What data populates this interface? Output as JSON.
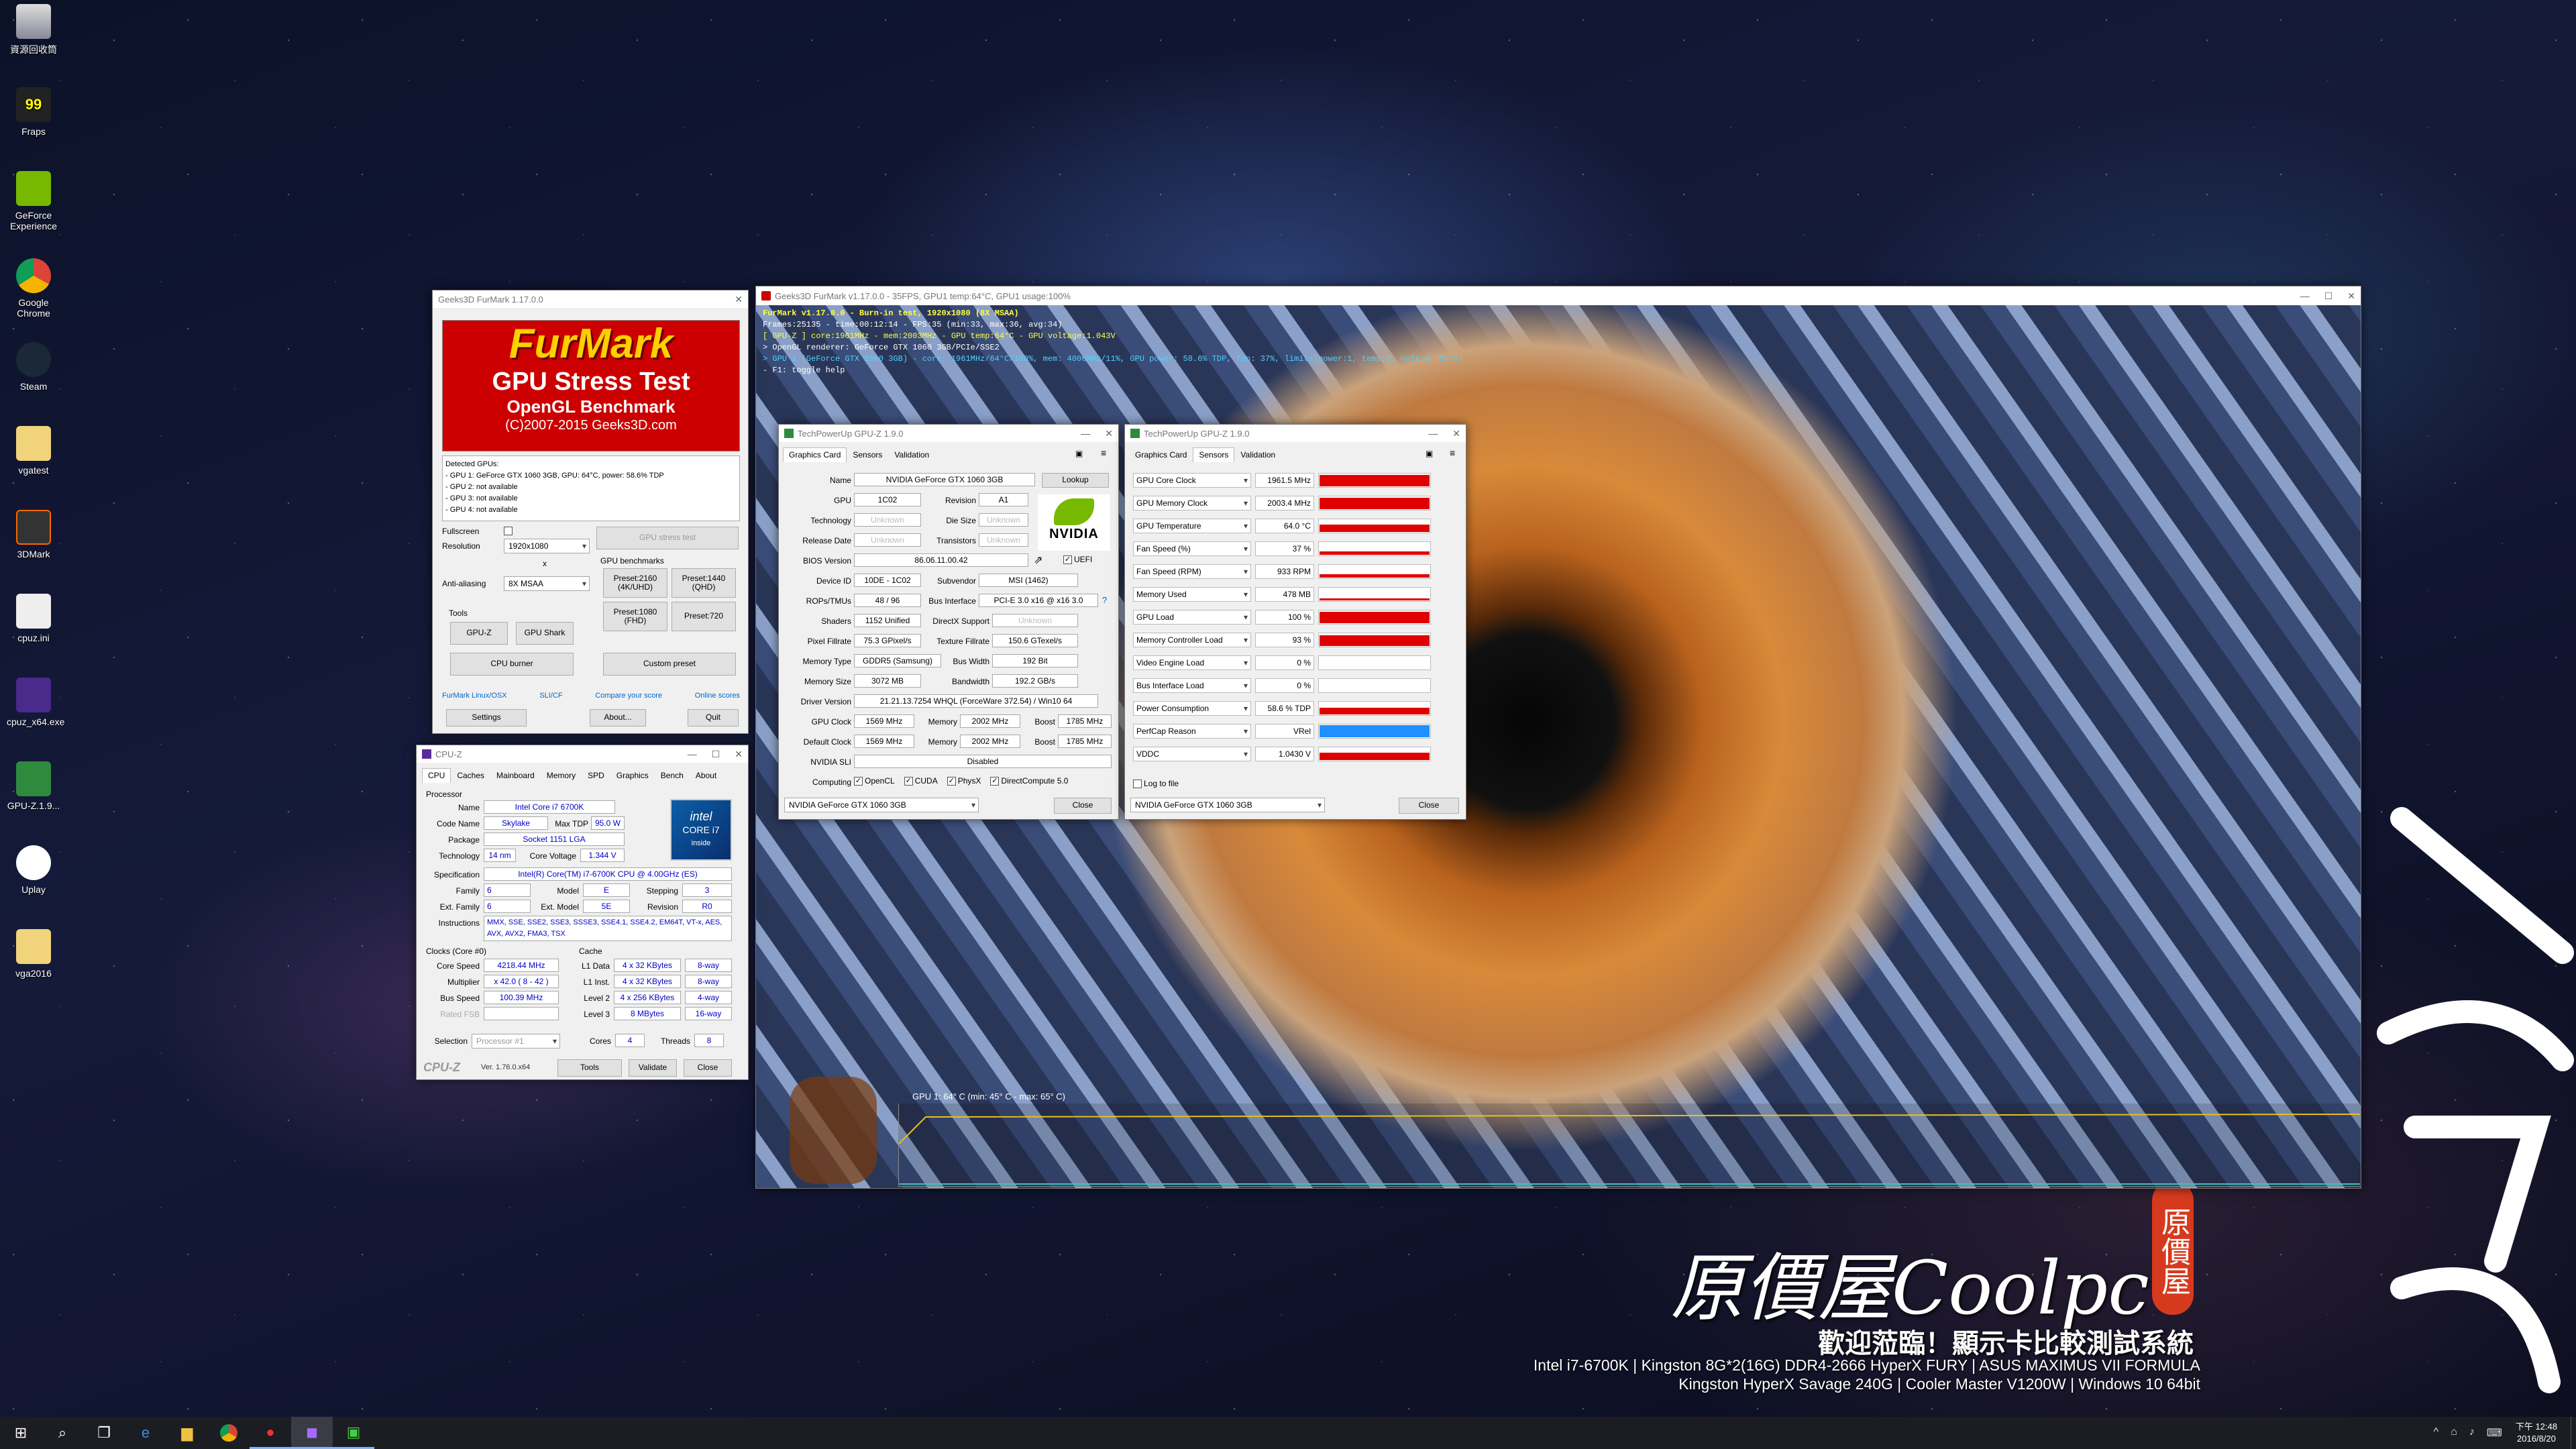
{
  "desktop": {
    "icons": [
      {
        "label": "資源回收筒"
      },
      {
        "label": "Fraps"
      },
      {
        "label": "GeForce Experience"
      },
      {
        "label": "Google Chrome"
      },
      {
        "label": "Steam"
      },
      {
        "label": "vgatest"
      },
      {
        "label": "3DMark"
      },
      {
        "label": "cpuz.ini"
      },
      {
        "label": "cpuz_x64.exe"
      },
      {
        "label": "GPU-Z.1.9..."
      },
      {
        "label": "Uplay"
      },
      {
        "label": "vga2016"
      }
    ],
    "brand": {
      "name": "原價屋Coolpc",
      "seal": "原價屋",
      "welcome": "歡迎蒞臨！顯示卡比較測試系統",
      "spec1": "Intel i7-6700K | Kingston 8G*2(16G) DDR4-2666 HyperX FURY | ASUS MAXIMUS VII FORMULA",
      "spec2": "Kingston HyperX Savage 240G | Cooler Master V1200W | Windows 10 64bit"
    }
  },
  "furmark": {
    "title": "Geeks3D FurMark 1.17.0.0",
    "logo_main": "FurMark",
    "logo_sub": "GPU Stress Test",
    "logo_sub2": "OpenGL Benchmark",
    "logo_copy": "(C)2007-2015 Geeks3D.com",
    "detected": [
      "Detected GPUs:",
      "- GPU 1: GeForce GTX 1060 3GB, GPU: 64°C, power: 58.6% TDP",
      "- GPU 2: not available",
      "- GPU 3: not available",
      "- GPU 4: not available"
    ],
    "fullscreen_label": "Fullscreen",
    "resolution_label": "Resolution",
    "resolution": "1920x1080",
    "x_label": "x",
    "aa_label": "Anti-aliasing",
    "aa": "8X MSAA",
    "stress_btn": "GPU stress test",
    "bench_label": "GPU benchmarks",
    "preset_2160": "Preset:2160 (4K/UHD)",
    "preset_1440": "Preset:1440 (QHD)",
    "preset_1080": "Preset:1080 (FHD)",
    "preset_720": "Preset:720",
    "tools_label": "Tools",
    "gpuz_btn": "GPU-Z",
    "gpushark_btn": "GPU Shark",
    "cpuburner_btn": "CPU burner",
    "custom_btn": "Custom preset",
    "link_linux": "FurMark Linux/OSX",
    "link_sli": "SLI/CF",
    "link_compare": "Compare your score",
    "link_online": "Online scores",
    "settings_btn": "Settings",
    "about_btn": "About...",
    "quit_btn": "Quit"
  },
  "render": {
    "title": "Geeks3D FurMark v1.17.0.0 - 35FPS, GPU1 temp:64°C, GPU1 usage:100%",
    "hud": [
      "FurMark v1.17.0.0 - Burn-in test, 1920x1080 (8X MSAA)",
      "Frames:25135 - time:00:12:14 - FPS:35 (min:33, max:36, avg:34)",
      "[ GPU-Z ] core:1961MHz - mem:2003MHz - GPU temp:64°C - GPU voltage:1.043V",
      "> OpenGL renderer: GeForce GTX 1060 3GB/PCIe/SSE2",
      "> GPU 1 (GeForce GTX 1060 3GB) - core: 1961MHz/64°C/100%, mem: 4006MHz/11%, GPU power: 58.6% TDP, fan: 37%, limits[power:1, temp:0, volt:0, OV:0]",
      "- F1: toggle help"
    ],
    "temp_label": "GPU 1: 64° C (min: 45° C - max: 65° C)"
  },
  "gpuz_card": {
    "title": "TechPowerUp GPU-Z 1.9.0",
    "tabs": [
      "Graphics Card",
      "Sensors",
      "Validation"
    ],
    "name_l": "Name",
    "name": "NVIDIA GeForce GTX 1060 3GB",
    "lookup": "Lookup",
    "gpu_l": "GPU",
    "gpu": "1C02",
    "rev_l": "Revision",
    "rev": "A1",
    "tech_l": "Technology",
    "tech": "Unknown",
    "die_l": "Die Size",
    "die": "Unknown",
    "rel_l": "Release Date",
    "rel": "Unknown",
    "trans_l": "Transistors",
    "trans": "Unknown",
    "bios_l": "BIOS Version",
    "bios": "86.06.11.00.42",
    "uefi": "UEFI",
    "dev_l": "Device ID",
    "dev": "10DE - 1C02",
    "sub_l": "Subvendor",
    "sub": "MSI (1462)",
    "rops_l": "ROPs/TMUs",
    "rops": "48 / 96",
    "bus_l": "Bus Interface",
    "bus": "PCI-E 3.0 x16 @ x16 3.0",
    "q": "?",
    "shad_l": "Shaders",
    "shad": "1152 Unified",
    "dx_l": "DirectX Support",
    "dx": "Unknown",
    "pix_l": "Pixel Fillrate",
    "pix": "75.3 GPixel/s",
    "tex_l": "Texture Fillrate",
    "tex": "150.6 GTexel/s",
    "mt_l": "Memory Type",
    "mt": "GDDR5 (Samsung)",
    "bw_l": "Bus Width",
    "bw": "192 Bit",
    "ms_l": "Memory Size",
    "ms": "3072 MB",
    "band_l": "Bandwidth",
    "band": "192.2 GB/s",
    "drv_l": "Driver Version",
    "drv": "21.21.13.7254 WHQL (ForceWare 372.54) / Win10 64",
    "gc_l": "GPU Clock",
    "gc": "1569 MHz",
    "mem_l": "Memory",
    "gm": "2002 MHz",
    "boost_l": "Boost",
    "gb": "1785 MHz",
    "dc_l": "Default Clock",
    "dc": "1569 MHz",
    "dm": "2002 MHz",
    "db": "1785 MHz",
    "sli_l": "NVIDIA SLI",
    "sli": "Disabled",
    "comp_l": "Computing",
    "opencl": "OpenCL",
    "cuda": "CUDA",
    "physx": "PhysX",
    "dc5": "DirectCompute 5.0",
    "select": "NVIDIA GeForce GTX 1060 3GB",
    "close": "Close",
    "nvidia": "NVIDIA"
  },
  "gpuz_sensors": {
    "title": "TechPowerUp GPU-Z 1.9.0",
    "tabs": [
      "Graphics Card",
      "Sensors",
      "Validation"
    ],
    "rows": [
      {
        "name": "GPU Core Clock",
        "value": "1961.5 MHz"
      },
      {
        "name": "GPU Memory Clock",
        "value": "2003.4 MHz"
      },
      {
        "name": "GPU Temperature",
        "value": "64.0 °C"
      },
      {
        "name": "Fan Speed (%)",
        "value": "37 %"
      },
      {
        "name": "Fan Speed (RPM)",
        "value": "933 RPM"
      },
      {
        "name": "Memory Used",
        "value": "478 MB"
      },
      {
        "name": "GPU Load",
        "value": "100 %"
      },
      {
        "name": "Memory Controller Load",
        "value": "93 %"
      },
      {
        "name": "Video Engine Load",
        "value": "0 %"
      },
      {
        "name": "Bus Interface Load",
        "value": "0 %"
      },
      {
        "name": "Power Consumption",
        "value": "58.6 % TDP"
      },
      {
        "name": "PerfCap Reason",
        "value": "VRel"
      },
      {
        "name": "VDDC",
        "value": "1.0430 V"
      }
    ],
    "bar_levels": [
      0.95,
      0.95,
      0.6,
      0.3,
      0.3,
      0.15,
      0.95,
      0.9,
      0,
      0,
      0.55,
      1,
      0.6
    ],
    "log": "Log to file",
    "select": "NVIDIA GeForce GTX 1060 3GB",
    "close": "Close"
  },
  "cpuz": {
    "title": "CPU-Z",
    "tabs": [
      "CPU",
      "Caches",
      "Mainboard",
      "Memory",
      "SPD",
      "Graphics",
      "Bench",
      "About"
    ],
    "proc_l": "Processor",
    "name_l": "Name",
    "name": "Intel Core i7 6700K",
    "code_l": "Code Name",
    "code": "Skylake",
    "tdp_l": "Max TDP",
    "tdp": "95.0 W",
    "pkg_l": "Package",
    "pkg": "Socket 1151 LGA",
    "tech_l": "Technology",
    "tech": "14 nm",
    "cv_l": "Core Voltage",
    "cv": "1.344 V",
    "spec_l": "Specification",
    "spec": "Intel(R) Core(TM) i7-6700K CPU @ 4.00GHz (ES)",
    "fam_l": "Family",
    "fam": "6",
    "mod_l": "Model",
    "mod": "E",
    "step_l": "Stepping",
    "step": "3",
    "ef_l": "Ext. Family",
    "ef": "6",
    "em_l": "Ext. Model",
    "em": "5E",
    "rv_l": "Revision",
    "rv": "R0",
    "ins_l": "Instructions",
    "ins": "MMX, SSE, SSE2, SSE3, SSSE3, SSE4.1, SSE4.2, EM64T, VT-x, AES, AVX, AVX2, FMA3, TSX",
    "clk_l": "Clocks (Core #0)",
    "cs_l": "Core Speed",
    "cs": "4218.44 MHz",
    "mul_l": "Multiplier",
    "mul": "x 42.0 ( 8 - 42 )",
    "bs_l": "Bus Speed",
    "bs": "100.39 MHz",
    "fsb_l": "Rated FSB",
    "cache_l": "Cache",
    "l1d_l": "L1 Data",
    "l1d": "4 x 32 KBytes",
    "l1d_w": "8-way",
    "l1i_l": "L1 Inst.",
    "l1i": "4 x 32 KBytes",
    "l1i_w": "8-way",
    "l2_l": "Level 2",
    "l2": "4 x 256 KBytes",
    "l2_w": "4-way",
    "l3_l": "Level 3",
    "l3": "8 MBytes",
    "l3_w": "16-way",
    "sel_l": "Selection",
    "sel": "Processor #1",
    "cores_l": "Cores",
    "cores": "4",
    "thr_l": "Threads",
    "thr": "8",
    "brand": "CPU-Z",
    "ver": "Ver. 1.76.0.x64",
    "tools": "Tools",
    "validate": "Validate",
    "close": "Close",
    "intel_a": "intel",
    "intel_b": "CORE i7",
    "intel_c": "inside"
  },
  "taskbar": {
    "time": "下午 12:48",
    "date": "2016/8/20"
  },
  "colors": {
    "red_bar": "#e00000",
    "blue_bar": "#1e90ff",
    "hud_yellow": "#ffff40",
    "hud_cyan": "#50d0ff"
  }
}
